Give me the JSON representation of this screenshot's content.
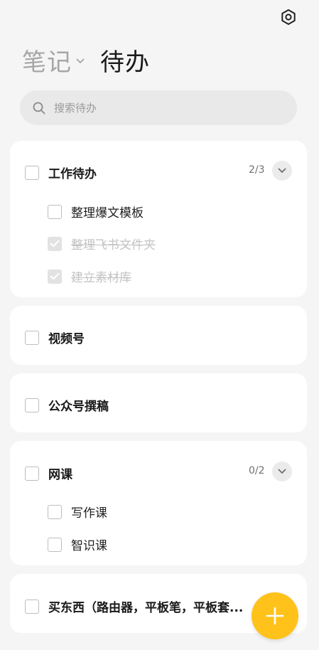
{
  "header": {
    "notes_tab": "笔记",
    "todo_tab": "待办"
  },
  "search": {
    "placeholder": "搜索待办"
  },
  "groups": [
    {
      "title": "工作待办",
      "count": "2/3",
      "items": [
        {
          "label": "整理爆文模板",
          "done": false
        },
        {
          "label": "整理飞书文件夹",
          "done": true
        },
        {
          "label": "建立素材库",
          "done": true
        }
      ]
    },
    {
      "title": "视频号"
    },
    {
      "title": "公众号撰稿"
    },
    {
      "title": "网课",
      "count": "0/2",
      "items": [
        {
          "label": "写作课",
          "done": false
        },
        {
          "label": "智识课",
          "done": false
        }
      ]
    },
    {
      "title": "买东西（路由器，平板笔，平板套..."
    }
  ],
  "colors": {
    "background": "#f5f5f5",
    "card": "#ffffff",
    "fab": "#ffc21a",
    "muted_text": "#a6a6a6",
    "done_text": "#c3c3c3"
  },
  "icons": {
    "settings": "gear-icon",
    "notes_dropdown": "chevron-down-icon",
    "search": "search-icon",
    "expand": "chevron-down-icon",
    "checked": "check-icon",
    "add": "plus-icon"
  }
}
